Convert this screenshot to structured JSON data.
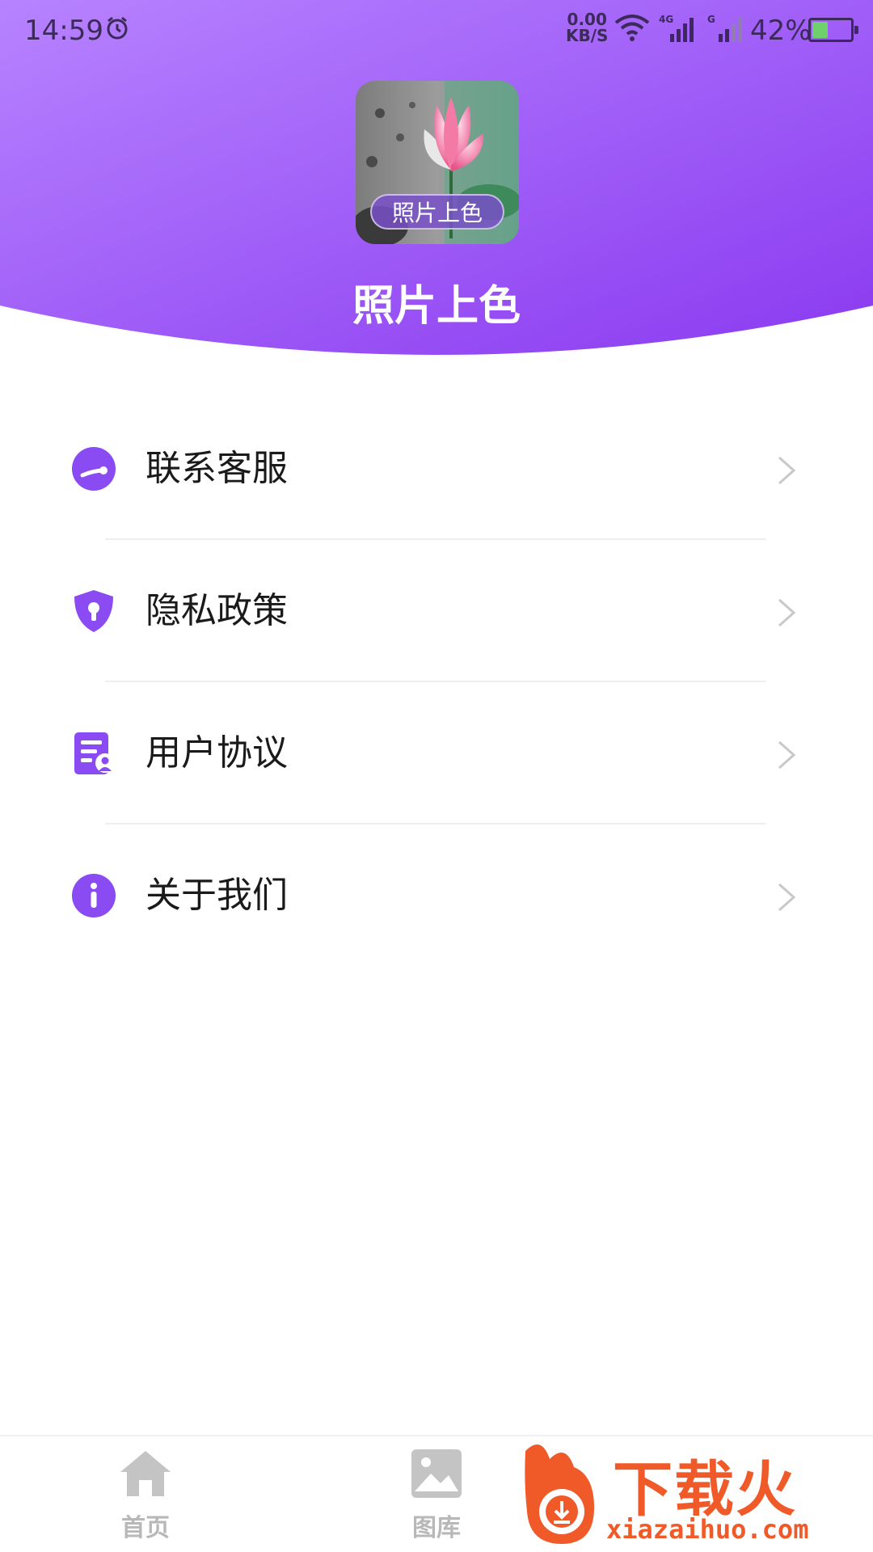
{
  "status_bar": {
    "time": "14:59",
    "net_speed_value": "0.00",
    "net_speed_unit": "KB/S",
    "signal1_label": "4G",
    "signal2_label": "G",
    "battery_pct": "42%",
    "battery_level": 0.42
  },
  "header": {
    "app_icon_badge": "照片上色",
    "app_name": "照片上色",
    "gradient_start": "#b06cff",
    "gradient_end": "#8b3df2"
  },
  "menu": {
    "items": [
      {
        "label": "联系客服",
        "icon": "customer-service-icon"
      },
      {
        "label": "隐私政策",
        "icon": "shield-lock-icon"
      },
      {
        "label": "用户协议",
        "icon": "document-user-icon"
      },
      {
        "label": "关于我们",
        "icon": "info-icon"
      }
    ],
    "accent": "#8b4bf2"
  },
  "bottom_nav": {
    "items": [
      {
        "label": "首页",
        "icon": "home-icon"
      },
      {
        "label": "图库",
        "icon": "gallery-icon"
      },
      {
        "label": "",
        "icon": "profile-icon"
      }
    ],
    "inactive_color": "#b8b8b8"
  },
  "watermark": {
    "brand": "下载火",
    "url": "xiazaihuo.com",
    "color": "#f05a28"
  }
}
